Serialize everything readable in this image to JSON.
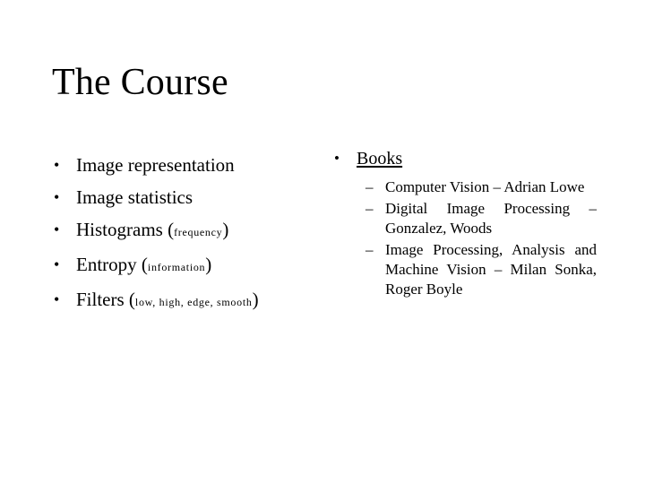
{
  "slide": {
    "title": "The Course",
    "background_color": "#ffffff",
    "text_color": "#000000"
  },
  "left_column": {
    "bullet_mark": "•",
    "items": [
      {
        "text": "Image representation",
        "annotation": ""
      },
      {
        "text": "Image statistics",
        "annotation": ""
      },
      {
        "text": "Histograms",
        "annotation": "frequency"
      },
      {
        "text": "Entropy",
        "annotation": "information"
      },
      {
        "text": "Filters",
        "annotation": "low, high, edge, smooth"
      }
    ]
  },
  "right_column": {
    "bullet_mark": "•",
    "dash_mark": "–",
    "heading": "Books",
    "books": [
      {
        "text": "Computer Vision –    Adrian Lowe"
      },
      {
        "text": "Digital Image Processing – Gonzalez, Woods"
      },
      {
        "text": "Image Processing, Analysis and Machine Vision – Milan Sonka, Roger Boyle"
      }
    ]
  }
}
